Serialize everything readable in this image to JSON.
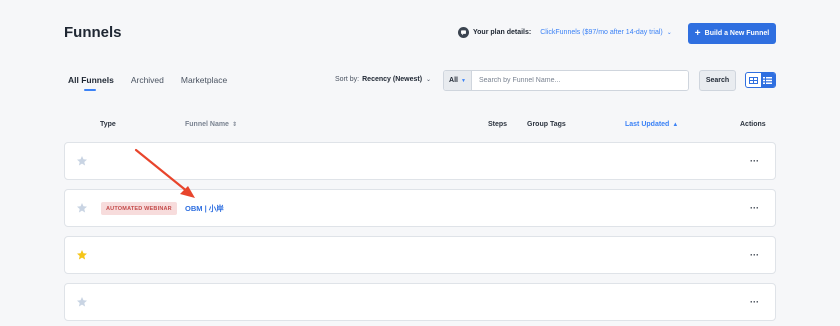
{
  "header": {
    "title": "Funnels",
    "plan_label": "Your plan details:",
    "plan_value": "ClickFunnels ($97/mo after 14-day trial)",
    "build_button": "Build a New Funnel"
  },
  "tabs": [
    {
      "label": "All Funnels",
      "active": true
    },
    {
      "label": "Archived",
      "active": false
    },
    {
      "label": "Marketplace",
      "active": false
    }
  ],
  "sort": {
    "label": "Sort by:",
    "value": "Recency (Newest)"
  },
  "search": {
    "filter_value": "All",
    "placeholder": "Search by Funnel Name...",
    "value": "",
    "button": "Search"
  },
  "columns": {
    "type": "Type",
    "funnel_name": "Funnel Name",
    "steps": "Steps",
    "group_tags": "Group Tags",
    "last_updated": "Last Updated",
    "actions": "Actions"
  },
  "rows": [
    {
      "starred": false,
      "type": "",
      "name": "",
      "actions": "···"
    },
    {
      "starred": false,
      "type": "AUTOMATED WEBINAR",
      "name": "OBM | 小岸",
      "actions": "···"
    },
    {
      "starred": true,
      "type": "",
      "name": "",
      "actions": "···"
    },
    {
      "starred": false,
      "type": "",
      "name": "",
      "actions": "···"
    }
  ],
  "colors": {
    "accent": "#2f6fe0",
    "star_off": "#c9d4e3",
    "star_on": "#f5c518",
    "badge_bg": "#f7dcdc",
    "badge_text": "#c44a4a",
    "annotation_arrow": "#e8452c"
  }
}
